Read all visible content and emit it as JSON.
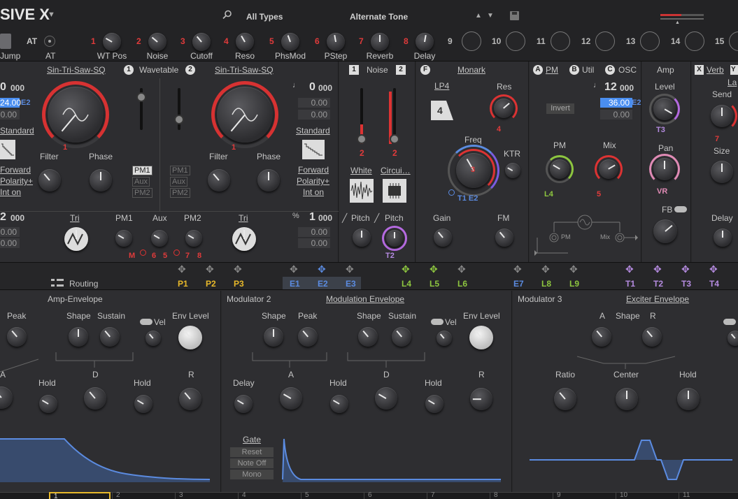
{
  "app": {
    "title": "SIVE X",
    "menu_arrow": "▼"
  },
  "browser": {
    "category": "All Types",
    "preset": "Alternate Tone"
  },
  "top_macros": [
    {
      "num": "1",
      "label": "WT Pos"
    },
    {
      "num": "2",
      "label": "Noise"
    },
    {
      "num": "3",
      "label": "Cutoff"
    },
    {
      "num": "4",
      "label": "Reso"
    },
    {
      "num": "5",
      "label": "PhsMod"
    },
    {
      "num": "6",
      "label": "PStep"
    },
    {
      "num": "7",
      "label": "Reverb"
    },
    {
      "num": "8",
      "label": "Delay"
    },
    {
      "num": "9",
      "label": ""
    },
    {
      "num": "10",
      "label": ""
    },
    {
      "num": "11",
      "label": ""
    },
    {
      "num": "12",
      "label": ""
    },
    {
      "num": "13",
      "label": ""
    },
    {
      "num": "14",
      "label": ""
    },
    {
      "num": "15",
      "label": ""
    }
  ],
  "top_left": {
    "jump": "Jump",
    "at_red": "AT",
    "at": "AT"
  },
  "wavetable": {
    "osc1_wave": "Sin-Tri-Saw-SQ",
    "title": "Wavetable",
    "osc2_wave": "Sin-Tri-Saw-SQ",
    "badge1": "1",
    "badge2": "2",
    "left_val_big": "0",
    "left_val_small": "000",
    "left_sel": "24.00",
    "left_e2": "E2",
    "left_box2": "0.00",
    "left_standard": "Standard",
    "left_forward": "Forward",
    "left_polarity": "Polarity+",
    "left_inton": "Int on",
    "left_filter": "Filter",
    "left_phase": "Phase",
    "left_one": "1",
    "pm1": "PM1",
    "aux": "Aux",
    "pm2": "PM2",
    "right_filter": "Filter",
    "right_phase": "Phase",
    "right_one": "1",
    "right_val_big": "0",
    "right_val_small": "000",
    "right_box1": "0.00",
    "right_box2": "0.00",
    "right_standard": "Standard",
    "right_forward": "Forward",
    "right_polarity": "Polarity+",
    "right_inton": "Int on",
    "left_bottom_big": "2",
    "left_bottom_small": "000",
    "left_bottom_box1": "0.00",
    "left_bottom_box2": "0.00",
    "tri1": "Tri",
    "tri2": "Tri",
    "b_pm1": "PM1",
    "b_aux": "Aux",
    "b_pm2": "PM2",
    "b_m": "M",
    "b_6": "6",
    "b_5": "5",
    "b_7": "7",
    "b_8": "8",
    "right_bottom_big": "1",
    "right_bottom_small": "000",
    "right_bottom_box1": "0.00",
    "right_bottom_box2": "0.00"
  },
  "noise": {
    "title": "Noise",
    "badge1": "1",
    "badge2": "2",
    "val1": "2",
    "val2": "2",
    "white": "White",
    "circuit": "Circui…",
    "pitch1": "Pitch",
    "pitch2": "Pitch",
    "t2": "T2"
  },
  "filter": {
    "badge": "F",
    "name": "Monark",
    "mode": "LP4",
    "mode_num": "4",
    "res": "Res",
    "res_val": "4",
    "freq": "Freq",
    "freq_val": "3",
    "ktr": "KTR",
    "t1e2": "T1 E2",
    "gain": "Gain",
    "fm": "FM"
  },
  "mod_section": {
    "badge_a": "A",
    "pm": "PM",
    "badge_b": "B",
    "util": "Util",
    "badge_c": "C",
    "osc": "OSC",
    "val_big": "12",
    "val_small": "000",
    "invert": "Invert",
    "sel": "36.00",
    "sel_e": "E2",
    "box2": "0.00",
    "pm_knob": "PM",
    "mix": "Mix",
    "l4": "L4",
    "five": "5",
    "diag_pm": "PM",
    "diag_mix": "Mix"
  },
  "amp": {
    "title": "Amp",
    "level": "Level",
    "t3": "T3",
    "pan": "Pan",
    "vr": "VR",
    "fb": "FB"
  },
  "fx": {
    "badge_x": "X",
    "verb": "Verb",
    "badge_y": "Y",
    "la": "La",
    "send": "Send",
    "seven": "7",
    "size": "Size",
    "delay": "Delay"
  },
  "routing_bar": {
    "routing": "Routing",
    "slots": [
      {
        "label": "P1",
        "color": "#e8b92a"
      },
      {
        "label": "P2",
        "color": "#e8b92a"
      },
      {
        "label": "P3",
        "color": "#e8b92a"
      },
      {
        "label": "E1",
        "color": "#5b8be0"
      },
      {
        "label": "E2",
        "color": "#5b8be0"
      },
      {
        "label": "E3",
        "color": "#5b8be0"
      },
      {
        "label": "L4",
        "color": "#8dc63f"
      },
      {
        "label": "L5",
        "color": "#8dc63f"
      },
      {
        "label": "L6",
        "color": "#8dc63f"
      },
      {
        "label": "E7",
        "color": "#5b8be0"
      },
      {
        "label": "L8",
        "color": "#8dc63f"
      },
      {
        "label": "L9",
        "color": "#8dc63f"
      },
      {
        "label": "T1",
        "color": "#b58be0"
      },
      {
        "label": "T2",
        "color": "#b58be0"
      },
      {
        "label": "T3",
        "color": "#b58be0"
      },
      {
        "label": "T4",
        "color": "#b58be0"
      }
    ]
  },
  "env1": {
    "title": "Amp-Envelope",
    "peak": "Peak",
    "shape": "Shape",
    "sustain": "Sustain",
    "vel": "Vel",
    "env_level": "Env Level",
    "a": "A",
    "hold1": "Hold",
    "d": "D",
    "hold2": "Hold",
    "r": "R"
  },
  "env2": {
    "mod": "Modulator 2",
    "title": "Modulation Envelope",
    "shape1": "Shape",
    "peak": "Peak",
    "shape2": "Shape",
    "sustain": "Sustain",
    "vel": "Vel",
    "env_level": "Env Level",
    "delay": "Delay",
    "a": "A",
    "hold1": "Hold",
    "d": "D",
    "hold2": "Hold",
    "r": "R",
    "gate": "Gate",
    "reset": "Reset",
    "note_off": "Note Off",
    "mono": "Mono"
  },
  "env3": {
    "mod": "Modulator 3",
    "title": "Exciter Envelope",
    "a": "A",
    "shape": "Shape",
    "r": "R",
    "ratio": "Ratio",
    "center": "Center",
    "hold": "Hold"
  },
  "bottom_tabs": [
    "1",
    "2",
    "3",
    "4",
    "5",
    "6",
    "7",
    "8",
    "9",
    "10",
    "11"
  ]
}
